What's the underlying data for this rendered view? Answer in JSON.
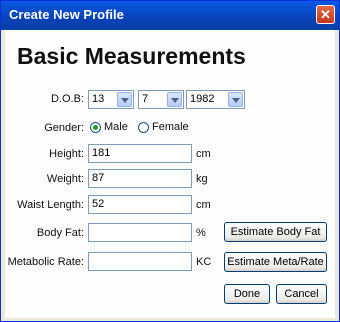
{
  "window": {
    "title": "Create New Profile",
    "close_glyph": "✕"
  },
  "heading": "Basic Measurements",
  "dob": {
    "label": "D.O.B:",
    "day": "13",
    "month": "7",
    "year": "1982"
  },
  "gender": {
    "label": "Gender:",
    "options": [
      "Male",
      "Female"
    ],
    "selected": "Male"
  },
  "height": {
    "label": "Height:",
    "value": "181",
    "unit": "cm"
  },
  "weight": {
    "label": "Weight:",
    "value": "87",
    "unit": "kg"
  },
  "waist": {
    "label": "Waist Length:",
    "value": "52",
    "unit": "cm"
  },
  "body_fat": {
    "label": "Body Fat:",
    "value": "",
    "unit": "%",
    "button": "Estimate Body Fat"
  },
  "metabolic": {
    "label": "Metabolic Rate:",
    "value": "",
    "unit": "KC",
    "button": "Estimate Meta/Rate"
  },
  "actions": {
    "done": "Done",
    "cancel": "Cancel"
  },
  "colors": {
    "title_bar": "#0842b8",
    "close_button": "#c5361a",
    "radio_selected": "#21a121"
  }
}
